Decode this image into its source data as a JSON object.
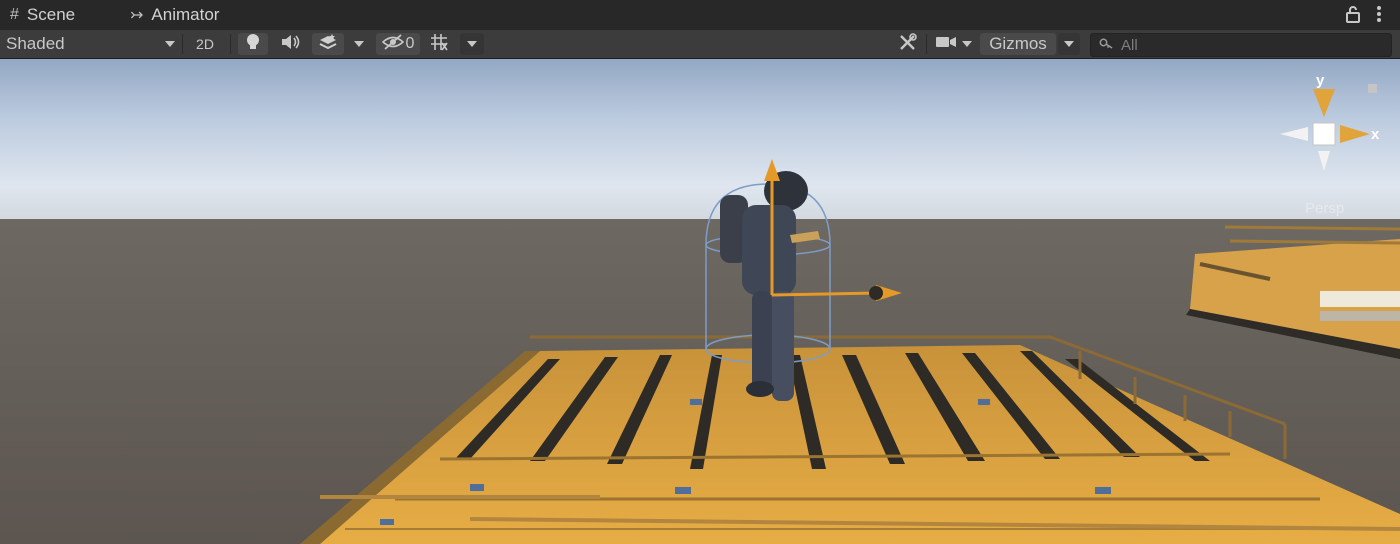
{
  "tabs": {
    "scene": {
      "icon": "#",
      "label": "Scene"
    },
    "animator": {
      "icon": "↣",
      "label": "Animator"
    }
  },
  "tab_actions": {
    "lock_icon": "lock-icon",
    "menu_icon": "more-icon"
  },
  "toolbar": {
    "shading_mode": "Shaded",
    "toggle_2d": "2D",
    "hidden_count": "0",
    "gizmos_label": "Gizmos",
    "search_placeholder": "All"
  },
  "orientation_gizmo": {
    "y_label": "y",
    "x_label": "x",
    "projection": "Persp"
  },
  "colors": {
    "tab_bg": "#282828",
    "toolbar_bg": "#3c3c3c",
    "accent_orange": "#e59a28",
    "platform_yellow": "#e0a63c",
    "sky_top": "#c6d6ea",
    "ground": "#5f5853"
  }
}
